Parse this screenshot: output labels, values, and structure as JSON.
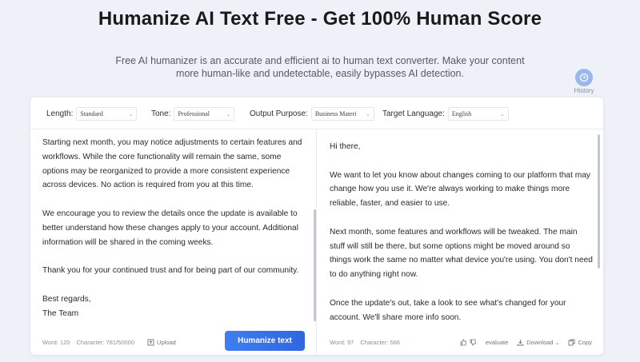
{
  "header": {
    "title": "Humanize AI Text Free - Get 100% Human Score",
    "subtitle_line1": "Free AI humanizer is an accurate and efficient ai to human text converter. Make your content",
    "subtitle_line2": "more human-like and undetectable, easily bypasses AI detection.",
    "history_label": "History"
  },
  "options": {
    "length_label": "Length:",
    "length_value": "Standard",
    "tone_label": "Tone:",
    "tone_value": "Professional",
    "purpose_label": "Output Purpose:",
    "purpose_value": "Business Materi",
    "language_label": "Target Language:",
    "language_value": "English"
  },
  "input": {
    "paragraphs": [
      "Starting next month, you may notice adjustments to certain features and workflows. While the core functionality will remain the same, some options may be reorganized to provide a more consistent experience across devices. No action is required from you at this time.",
      "We encourage you to review the details once the update is available to better understand how these changes apply to your account. Additional information will be shared in the coming weeks.",
      "Thank you for your continued trust and for being part of our community.",
      "Best regards,",
      "The Team"
    ],
    "word_count": "Word: 120",
    "char_count": "Character: 781/50000",
    "upload_label": "Upload",
    "humanize_label": "Humanize text"
  },
  "output": {
    "paragraphs": [
      "Hi there,",
      "We want to let you know about changes coming to our platform that may change how you use it.  We're always working to make things more reliable, faster, and easier to use.",
      "Next month, some features and workflows will be tweaked.  The main stuff will still be there, but some options might be moved around so things work the same no matter what device you're using.  You don't need to do anything right now.",
      "Once the update's out, take a look to see what's changed for your account.  We'll share more info soon."
    ],
    "word_count": "Word: 97",
    "char_count": "Character: 566",
    "evaluate_label": "evaluate",
    "download_label": "Download",
    "copy_label": "Copy"
  },
  "colors": {
    "accent": "#3a74ea",
    "background": "#eef1f7",
    "history_icon": "#9bb7ef"
  }
}
